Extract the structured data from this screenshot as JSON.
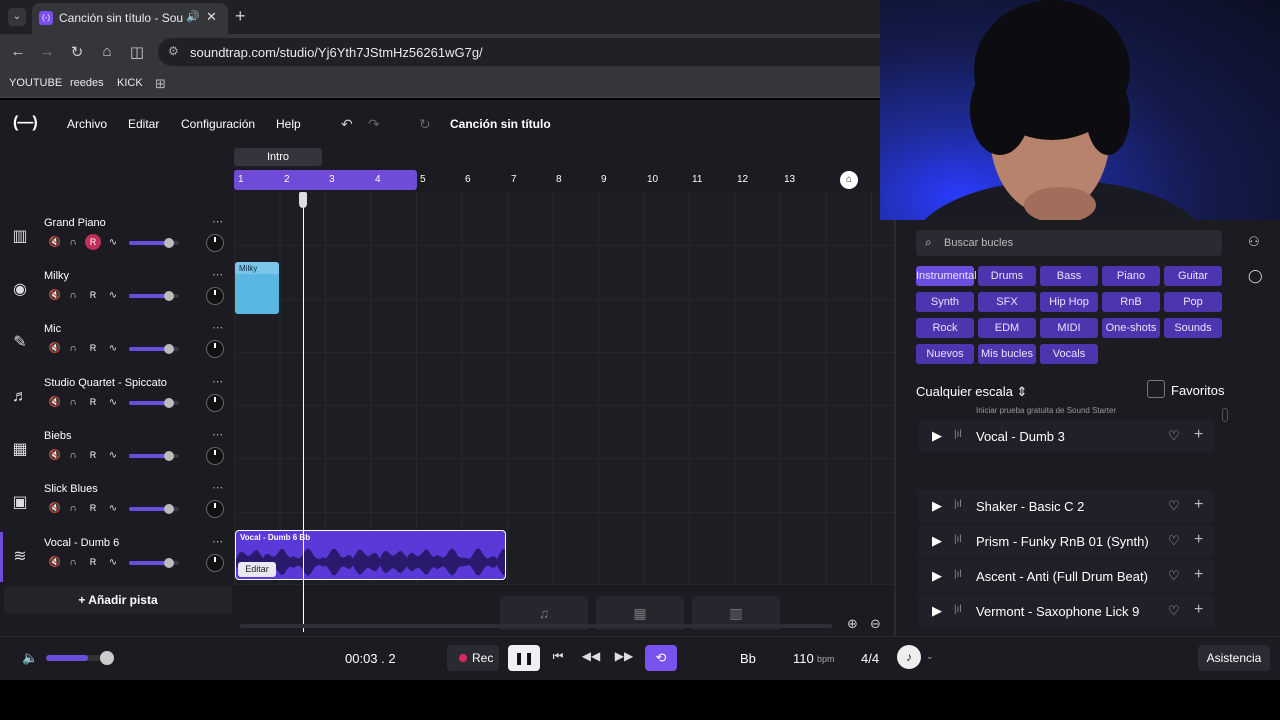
{
  "browser": {
    "tab_title": "Canción sin título - Soundtrap",
    "url": "soundtrap.com/studio/Yj6Yth7JStmHz56261wG7g/",
    "bookmarks": [
      "YOUTUBE",
      "reedes",
      "KICK"
    ]
  },
  "app": {
    "menu": [
      "Archivo",
      "Editar",
      "Configuración",
      "Help"
    ],
    "song_title": "Canción sin título"
  },
  "timeline": {
    "section": "Intro",
    "ticks": [
      "1",
      "2",
      "3",
      "4",
      "5",
      "6",
      "7",
      "8",
      "9",
      "10",
      "11",
      "12",
      "13"
    ]
  },
  "tracks": [
    {
      "name": "Grand Piano",
      "icon": "piano-icon",
      "rec_armed": true,
      "volume": 0.8
    },
    {
      "name": "Milky",
      "icon": "drum-icon",
      "rec_armed": false,
      "volume": 0.8
    },
    {
      "name": "Mic",
      "icon": "mic-icon",
      "rec_armed": false,
      "volume": 0.8
    },
    {
      "name": "Studio Quartet - Spiccato",
      "icon": "strings-icon",
      "rec_armed": false,
      "volume": 0.8
    },
    {
      "name": "Biebs",
      "icon": "keyboard-icon",
      "rec_armed": false,
      "volume": 0.8
    },
    {
      "name": "Slick Blues",
      "icon": "amp-icon",
      "rec_armed": false,
      "volume": 0.8
    },
    {
      "name": "Vocal - Dumb 6",
      "icon": "waveform-icon",
      "rec_armed": false,
      "volume": 0.8
    }
  ],
  "rec_label": "R",
  "add_track": "+ Añadir pista",
  "clips": {
    "milky": "Milky",
    "vocal": "Vocal - Dumb 6 Bb",
    "edit": "Editar"
  },
  "loops": {
    "search_placeholder": "Buscar bucles",
    "chips": [
      "Instrumental",
      "Drums",
      "Bass",
      "Piano",
      "Guitar",
      "Synth",
      "SFX",
      "Hip Hop",
      "RnB",
      "Pop",
      "Rock",
      "EDM",
      "MIDI",
      "One-shots",
      "Sounds",
      "Nuevos",
      "Mis bucles",
      "Vocals"
    ],
    "scale": "Cualquier escala",
    "favorites": "Favoritos",
    "trial_text": "Iniciar prueba gratuita de Sound Starter",
    "items": [
      "Vocal - Dumb 3",
      "Shaker - Basic C 2",
      "Prism - Funky RnB 01 (Synth)",
      "Ascent - Anti (Full Drum Beat)",
      "Vermont - Saxophone Lick 9"
    ]
  },
  "transport": {
    "time": "00:03 . 2",
    "rec": "Rec",
    "key": "Bb",
    "bpm": "110",
    "bpm_unit": "bpm",
    "signature": "4/4",
    "assist": "Asistencia",
    "master_volume": 0.7
  },
  "colors": {
    "accent": "#6f4bd8",
    "milky_clip": "#5ab6e2",
    "rec_armed": "#c0305a"
  }
}
